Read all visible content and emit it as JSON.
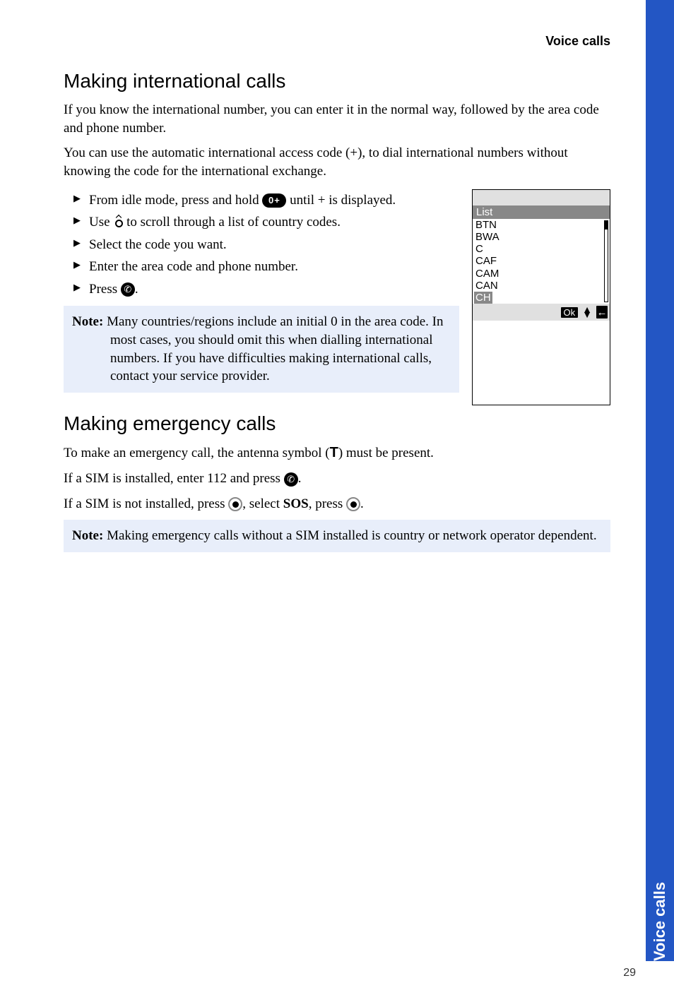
{
  "header": {
    "section": "Voice calls"
  },
  "s1": {
    "heading": "Making international calls",
    "p1": "If you know the international number, you can enter it in the normal way, followed by the area code and phone number.",
    "p2": "You can use the automatic international access code (+), to dial international numbers without knowing the code for the international exchange.",
    "b1a": "From idle mode, press and hold ",
    "b1b": "  until + is displayed.",
    "b2a": "Use ",
    "b2b": " to scroll through a list of country codes.",
    "b3": "Select the code you want.",
    "b4": "Enter the area code and phone number.",
    "b5a": "Press ",
    "b5b": ".",
    "note": {
      "label": "Note: ",
      "text": "Many countries/regions include an initial 0 in the area code. In most cases, you should omit this when dialling international numbers. If you have difficulties making international calls, contact your service provider."
    }
  },
  "phone": {
    "title": "List",
    "items": [
      "BTN",
      "BWA",
      "C",
      "CAF",
      "CAM",
      "CAN",
      "CH"
    ],
    "ok": "Ok"
  },
  "s2": {
    "heading": "Making emergency calls",
    "p1a": "To make an emergency call, the antenna symbol (",
    "p1b": ") must be present.",
    "p2a": "If a SIM is installed, enter 112 and press ",
    "p2b": ".",
    "p3a": "If a SIM is not installed, press ",
    "p3b": ", select ",
    "sos": "SOS",
    "p3c": ", press ",
    "p3d": ".",
    "note": {
      "label": "Note: ",
      "text": "Making emergency calls without a SIM installed is country or network operator dependent."
    }
  },
  "sidebar": {
    "label": "Voice calls"
  },
  "pageNumber": "29",
  "icons": {
    "zeroplus": "0+",
    "antenna": "T",
    "call": "✆",
    "back": "←"
  }
}
